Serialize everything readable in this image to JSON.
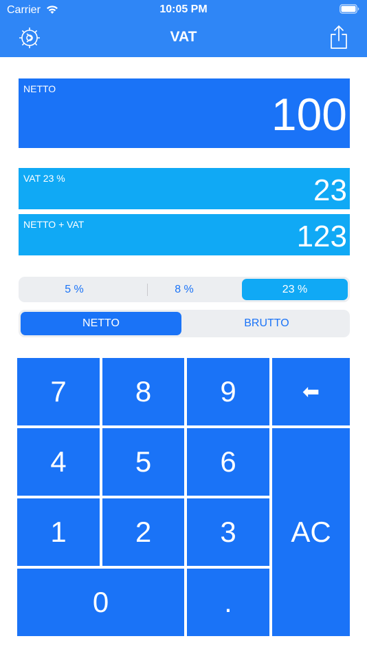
{
  "status_bar": {
    "carrier": "Carrier",
    "time": "10:05 PM"
  },
  "nav": {
    "title": "VAT",
    "settings_icon": "settings-gear-icon",
    "share_icon": "share-icon"
  },
  "display": {
    "netto_label": "NETTO",
    "netto_value": "100",
    "vat_label": "VAT 23 %",
    "vat_value": "23",
    "sum_label": "NETTO + VAT",
    "sum_value": "123"
  },
  "rates": {
    "options": [
      "5 %",
      "8 %",
      "23 %"
    ],
    "selected": "23 %"
  },
  "mode": {
    "options": [
      "NETTO",
      "BRUTTO"
    ],
    "selected": "NETTO"
  },
  "keypad": {
    "k7": "7",
    "k8": "8",
    "k9": "9",
    "backspace": "⬅",
    "k4": "4",
    "k5": "5",
    "k6": "6",
    "k1": "1",
    "k2": "2",
    "k3": "3",
    "clear": "AC",
    "k0": "0",
    "dot": "."
  },
  "colors": {
    "nav_bar": "#2f86f6",
    "primary_blue": "#1a73f7",
    "light_blue": "#10a9f5",
    "segment_bg": "#eceef1"
  }
}
